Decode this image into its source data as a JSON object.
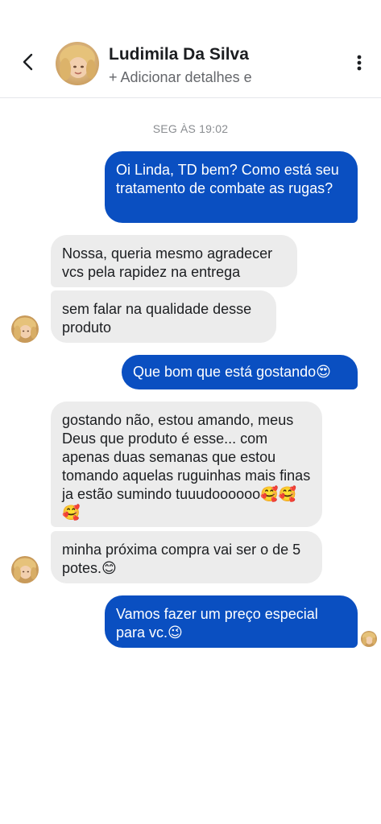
{
  "header": {
    "contact_name": "Ludimila Da Silva",
    "subtitle": "+ Adicionar detalhes e",
    "back_icon": "chevron-left-icon",
    "more_icon": "more-vertical-icon"
  },
  "conversation": {
    "timestamp": "SEG ÀS 19:02",
    "messages": [
      {
        "sender": "me",
        "text": "Oi Linda, TD bem? Como está seu tratamento de combate as rugas?"
      },
      {
        "sender": "contact",
        "text": "Nossa, queria mesmo agradecer vcs pela rapidez na entrega"
      },
      {
        "sender": "contact",
        "text": "sem falar na qualidade desse produto"
      },
      {
        "sender": "me",
        "text": "Que bom que está gostando😍"
      },
      {
        "sender": "contact",
        "text": "gostando não, estou amando, meus Deus que produto é esse... com apenas duas semanas que estou tomando aquelas ruguinhas mais finas ja estão sumindo tuuudoooooo🥰🥰🥰"
      },
      {
        "sender": "contact",
        "text": "minha próxima compra vai ser o de 5 potes.😊"
      },
      {
        "sender": "me",
        "text": "Vamos fazer um preço especial para vc.😉"
      }
    ]
  },
  "colors": {
    "outgoing_bubble": "#0a4fc1",
    "incoming_bubble": "#ececec",
    "timestamp_text": "#8a8d91"
  }
}
